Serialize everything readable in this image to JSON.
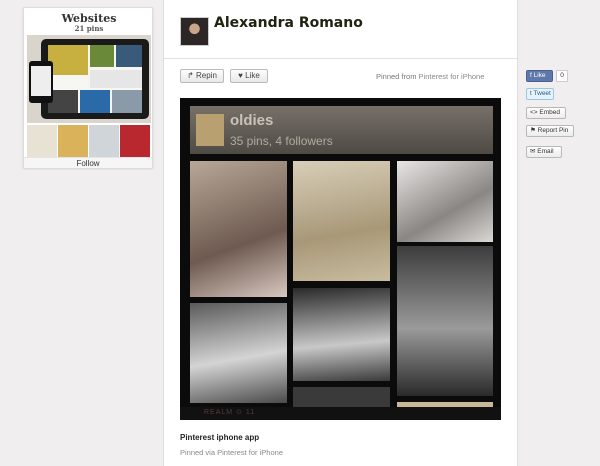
{
  "board": {
    "title": "Websites",
    "pin_count": "21 pins",
    "follow_label": "Follow"
  },
  "pin": {
    "user_name": "Alexandra Romano",
    "repin_label": "Repin",
    "like_label": "Like",
    "pinned_from_prefix": "Pinned from",
    "pinned_from_source": "Pinterest for iPhone",
    "caption": "Pinterest iphone app",
    "pinned_via_prefix": "Pinned via",
    "pinned_via_source": "Pinterest for iPhone"
  },
  "pin_image": {
    "board_name": "oldies",
    "board_stats": "35 pins, 4 followers",
    "footer_text": "REALM ⊙ 11"
  },
  "share": {
    "fb_like_label": "Like",
    "fb_like_count": "0",
    "tweet_label": "Tweet",
    "embed_label": "Embed",
    "report_label": "Report Pin",
    "email_label": "Email"
  },
  "colors": {
    "background": "#f0eeee",
    "panel": "#ffffff",
    "facebook": "#5f78ab",
    "twitter": "#e6f3fb"
  },
  "icons": {
    "repin": "pin-icon",
    "like": "heart-icon",
    "embed": "code-icon",
    "report": "flag-icon",
    "email": "envelope-icon",
    "facebook": "facebook-icon",
    "twitter": "twitter-icon"
  }
}
